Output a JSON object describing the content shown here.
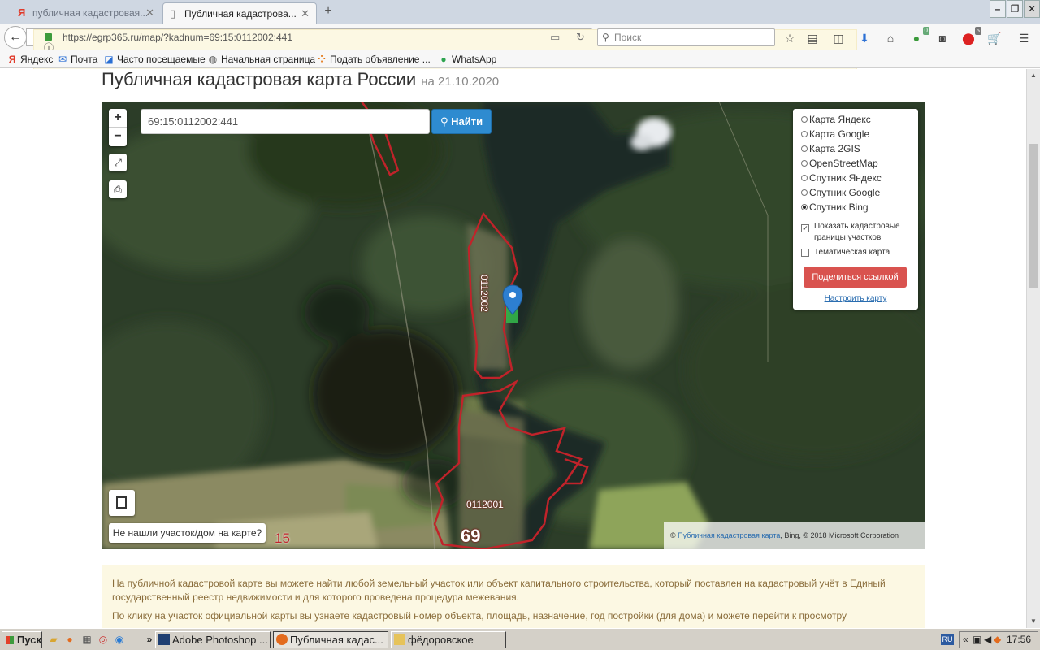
{
  "browser": {
    "tabs": [
      {
        "label": "публичная кадастровая...",
        "icon": "yandex-icon",
        "active": false
      },
      {
        "label": "Публичная кадастрова...",
        "icon": "page-icon",
        "active": true
      }
    ],
    "url": "https://egrp365.ru/map/?kadnum=69:15:0112002:441",
    "search_placeholder": "Поиск",
    "badges": {
      "sync": "0",
      "adblock": "5"
    },
    "bookmarks": [
      {
        "label": "Яндекс",
        "icon": "yandex-icon"
      },
      {
        "label": "Почта",
        "icon": "mail-icon"
      },
      {
        "label": "Часто посещаемые",
        "icon": "frequent-icon"
      },
      {
        "label": "Начальная страница",
        "icon": "globe-icon"
      },
      {
        "label": "Подать объявление ...",
        "icon": "ads-icon"
      },
      {
        "label": "WhatsApp",
        "icon": "whatsapp-icon"
      }
    ]
  },
  "page": {
    "title": "Публичная кадастровая карта России",
    "date": "на 21.10.2020"
  },
  "map": {
    "search_value": "69:15:0112002:441",
    "find_button": "Найти",
    "zoom_in": "+",
    "zoom_out": "−",
    "layers": [
      {
        "label": "Карта Яндекс",
        "selected": false
      },
      {
        "label": "Карта Google",
        "selected": false
      },
      {
        "label": "Карта 2GIS",
        "selected": false
      },
      {
        "label": "OpenStreetMap",
        "selected": false
      },
      {
        "label": "Спутник Яндекс",
        "selected": false
      },
      {
        "label": "Спутник Google",
        "selected": false
      },
      {
        "label": "Спутник Bing",
        "selected": true
      }
    ],
    "show_borders_label": "Показать кадастровые границы участков",
    "show_borders_checked": true,
    "thematic_label": "Тематическая карта",
    "thematic_checked": false,
    "share_button": "Поделиться ссылкой",
    "setup_link": "Настроить карту",
    "not_found_button": "Не нашли участок/дом на карте?",
    "attribution_prefix": "©",
    "attribution_link": "Публичная кадастровая карта",
    "attribution_suffix": ", Bing, © 2018 Microsoft Corporation",
    "labels": {
      "block_upper": "0112002",
      "block_lower": "0112001",
      "region": "69",
      "district": "15"
    }
  },
  "info": {
    "para1": "На публичной кадастровой карте вы можете найти любой земельный участок или объект капитального строительства, который поставлен на кадастровый учёт в Единый государственный реестр недвижимости и для которого проведена процедура межевания.",
    "para2": "По клику на участок официальной карты вы узнаете кадастровый номер объекта, площадь, назначение, год постройки (для дома) и можете перейти к просмотру"
  },
  "taskbar": {
    "start": "Пуск",
    "tasks": [
      {
        "label": "Adobe Photoshop ...",
        "icon": "photoshop-icon",
        "active": false
      },
      {
        "label": "Публичная кадас...",
        "icon": "firefox-icon",
        "active": true
      },
      {
        "label": "фёдоровское",
        "icon": "folder-icon",
        "active": false
      }
    ],
    "lang": "RU",
    "time": "17:56"
  }
}
